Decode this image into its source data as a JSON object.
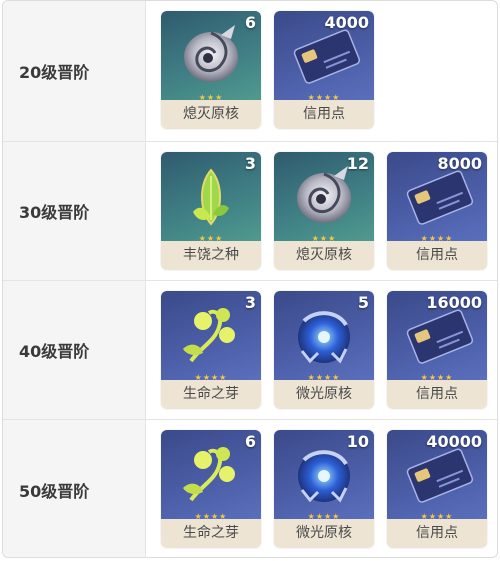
{
  "rows": [
    {
      "label": "20级晋阶",
      "items": [
        {
          "name": "熄灭原核",
          "count": "6",
          "icon": "extinguished-core-icon",
          "rarity": 3
        },
        {
          "name": "信用点",
          "count": "4000",
          "icon": "credit-card-icon",
          "rarity": 4
        }
      ]
    },
    {
      "label": "30级晋阶",
      "items": [
        {
          "name": "丰饶之种",
          "count": "3",
          "icon": "abundance-seed-icon",
          "rarity": 3
        },
        {
          "name": "熄灭原核",
          "count": "12",
          "icon": "extinguished-core-icon",
          "rarity": 3
        },
        {
          "name": "信用点",
          "count": "8000",
          "icon": "credit-card-icon",
          "rarity": 4
        }
      ]
    },
    {
      "label": "40级晋阶",
      "items": [
        {
          "name": "生命之芽",
          "count": "3",
          "icon": "life-sprout-icon",
          "rarity": 4
        },
        {
          "name": "微光原核",
          "count": "5",
          "icon": "glimmering-core-icon",
          "rarity": 4
        },
        {
          "name": "信用点",
          "count": "16000",
          "icon": "credit-card-icon",
          "rarity": 4
        }
      ]
    },
    {
      "label": "50级晋阶",
      "items": [
        {
          "name": "生命之芽",
          "count": "6",
          "icon": "life-sprout-icon",
          "rarity": 4
        },
        {
          "name": "微光原核",
          "count": "10",
          "icon": "glimmering-core-icon",
          "rarity": 4
        },
        {
          "name": "信用点",
          "count": "40000",
          "icon": "credit-card-icon",
          "rarity": 4
        }
      ]
    }
  ],
  "colors": {
    "rarity3_bg": "#3f7e84",
    "rarity4_bg": "#4b5da6",
    "name_bar": "#ede4d4",
    "star": "#f2c84a"
  }
}
